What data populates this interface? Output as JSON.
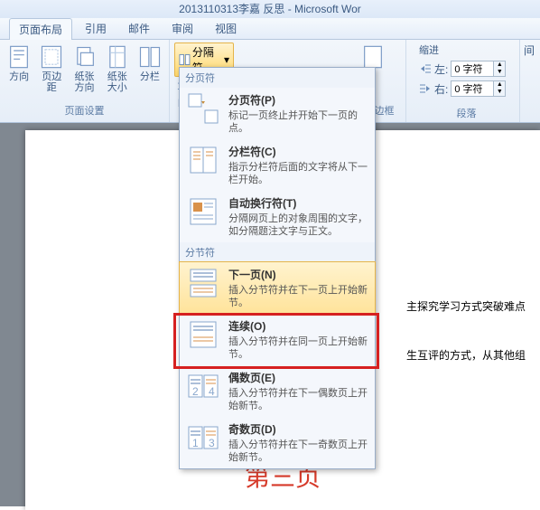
{
  "window": {
    "title": "2013110313李嘉 反思 - Microsoft Wor"
  },
  "tabs": [
    {
      "label": "页面布局",
      "active": true
    },
    {
      "label": "引用"
    },
    {
      "label": "邮件"
    },
    {
      "label": "审阅"
    },
    {
      "label": "视图"
    }
  ],
  "ribbon": {
    "pageSetup": {
      "label": "页面设置",
      "direction": "方向",
      "margins": "页边距",
      "orientation": "纸张方向",
      "size": "纸张大小",
      "columns": "分栏"
    },
    "breaks": {
      "label": "分隔符"
    },
    "pageBg": {
      "border": "页面边框"
    },
    "indent": {
      "label": "缩进",
      "leftLabel": "左:",
      "rightLabel": "右:",
      "leftValue": "0 字符",
      "rightValue": "0 字符"
    },
    "spacing": {
      "label": "间"
    },
    "paragraph": {
      "label": "段落"
    }
  },
  "dropdown": {
    "section1": "分页符",
    "items1": [
      {
        "title": "分页符(P)",
        "desc": "标记一页终止并开始下一页的点。"
      },
      {
        "title": "分栏符(C)",
        "desc": "指示分栏符后面的文字将从下一栏开始。"
      },
      {
        "title": "自动换行符(T)",
        "desc": "分隔网页上的对象周围的文字，如分隔题注文字与正文。"
      }
    ],
    "section2": "分节符",
    "items2": [
      {
        "title": "下一页(N)",
        "desc": "插入分节符并在下一页上开始新节。",
        "highlight": true
      },
      {
        "title": "连续(O)",
        "desc": "插入分节符并在同一页上开始新节。"
      },
      {
        "title": "偶数页(E)",
        "desc": "插入分节符并在下一偶数页上开始新节。"
      },
      {
        "title": "奇数页(D)",
        "desc": "插入分节符并在下一奇数页上开始新节。"
      }
    ]
  },
  "document": {
    "line1": "主探究学习方式突破难点",
    "line2": "生互评的方式，从其他组",
    "pageNum": "第三页"
  }
}
